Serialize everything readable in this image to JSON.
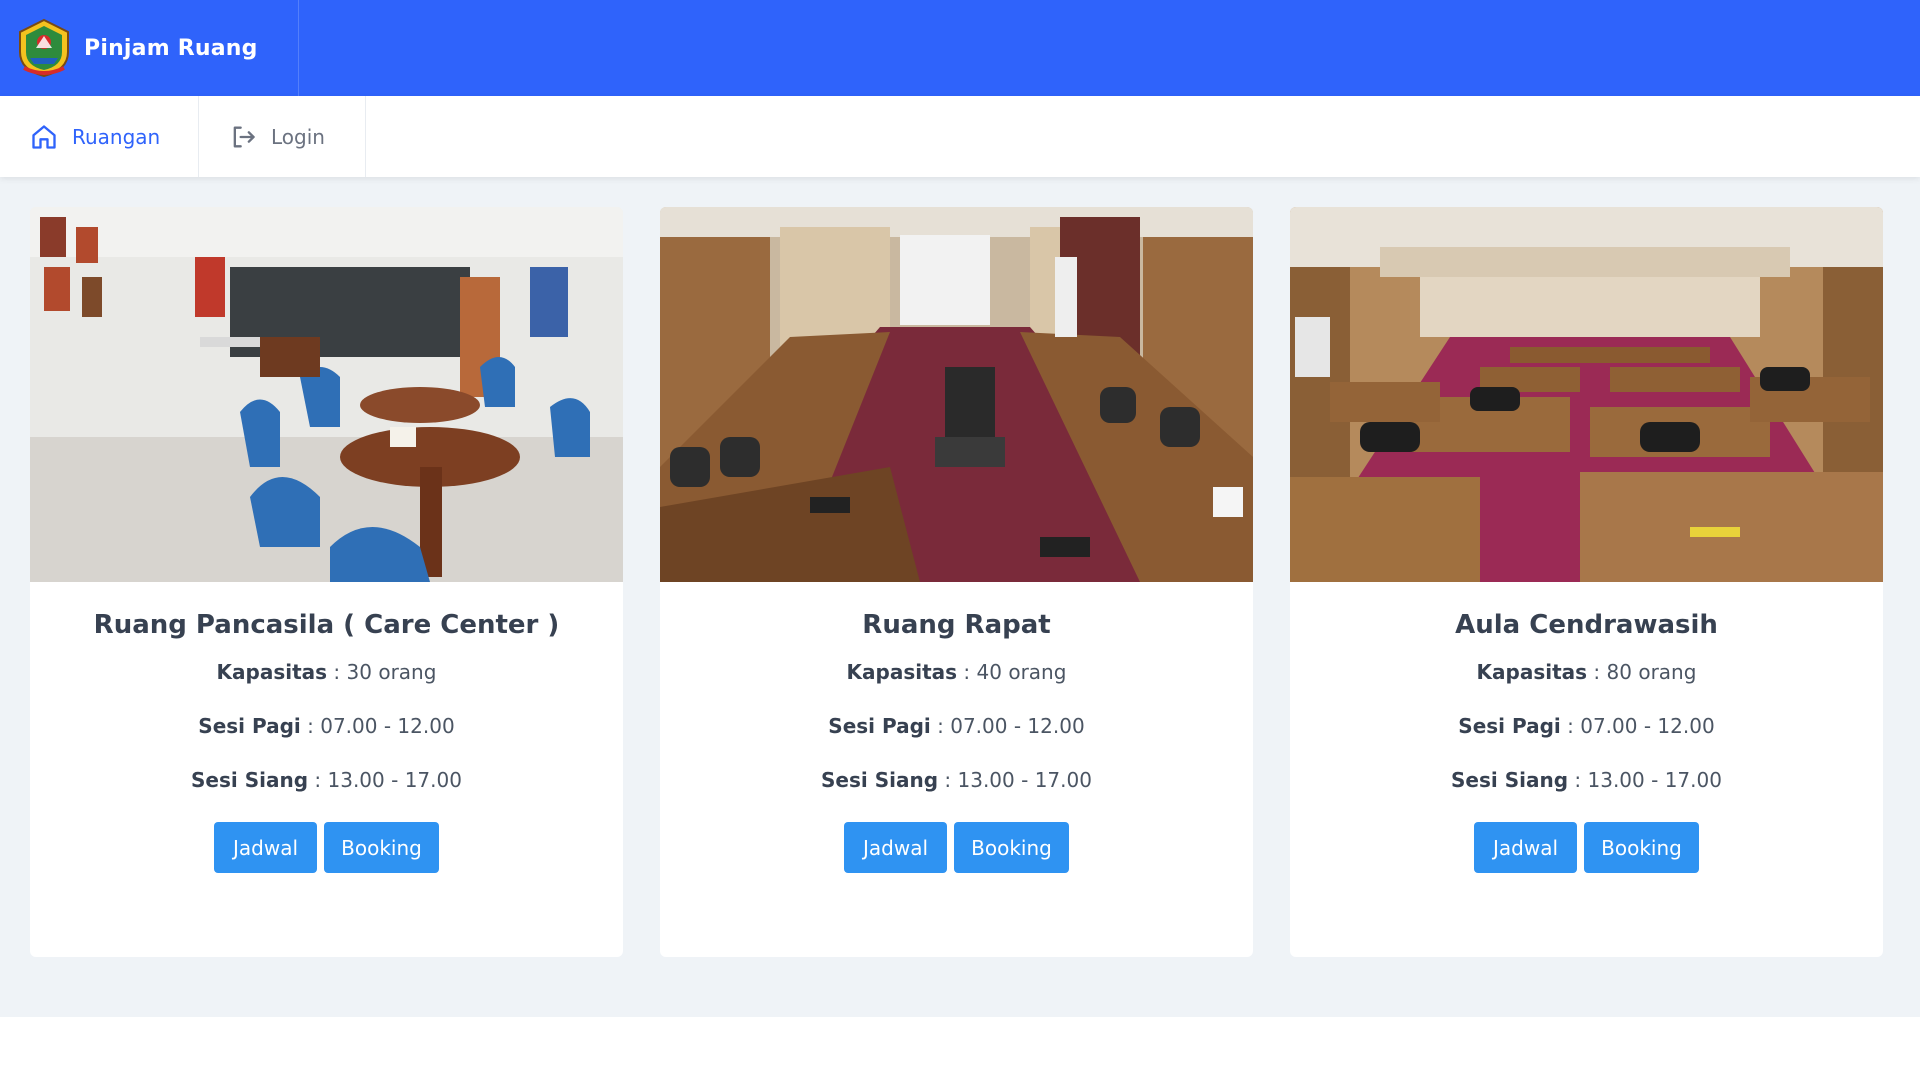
{
  "header": {
    "app_name": "Pinjam Ruang",
    "logo_icon": "province-emblem-icon",
    "bg_color": "#2f63fb"
  },
  "nav": {
    "items": [
      {
        "label": "Ruangan",
        "icon": "home-icon",
        "active": true
      },
      {
        "label": "Login",
        "icon": "login-icon",
        "active": false
      }
    ]
  },
  "rooms": [
    {
      "name": "Ruang Pancasila ( Care Center )",
      "capacity_label": "Kapasitas",
      "capacity_value": " : 30 orang",
      "morning_label": "Sesi Pagi",
      "morning_value": " : 07.00 - 12.00",
      "afternoon_label": "Sesi Siang",
      "afternoon_value": " : 13.00 - 17.00",
      "schedule_button": "Jadwal",
      "booking_button": "Booking"
    },
    {
      "name": "Ruang Rapat",
      "capacity_label": "Kapasitas",
      "capacity_value": " : 40 orang",
      "morning_label": "Sesi Pagi",
      "morning_value": " : 07.00 - 12.00",
      "afternoon_label": "Sesi Siang",
      "afternoon_value": " : 13.00 - 17.00",
      "schedule_button": "Jadwal",
      "booking_button": "Booking"
    },
    {
      "name": "Aula Cendrawasih",
      "capacity_label": "Kapasitas",
      "capacity_value": " : 80 orang",
      "morning_label": "Sesi Pagi",
      "morning_value": " : 07.00 - 12.00",
      "afternoon_label": "Sesi Siang",
      "afternoon_value": " : 13.00 - 17.00",
      "schedule_button": "Jadwal",
      "booking_button": "Booking"
    }
  ],
  "colors": {
    "accent": "#2f63fb",
    "button": "#2f93f2",
    "page_bg": "#eff3f7"
  }
}
